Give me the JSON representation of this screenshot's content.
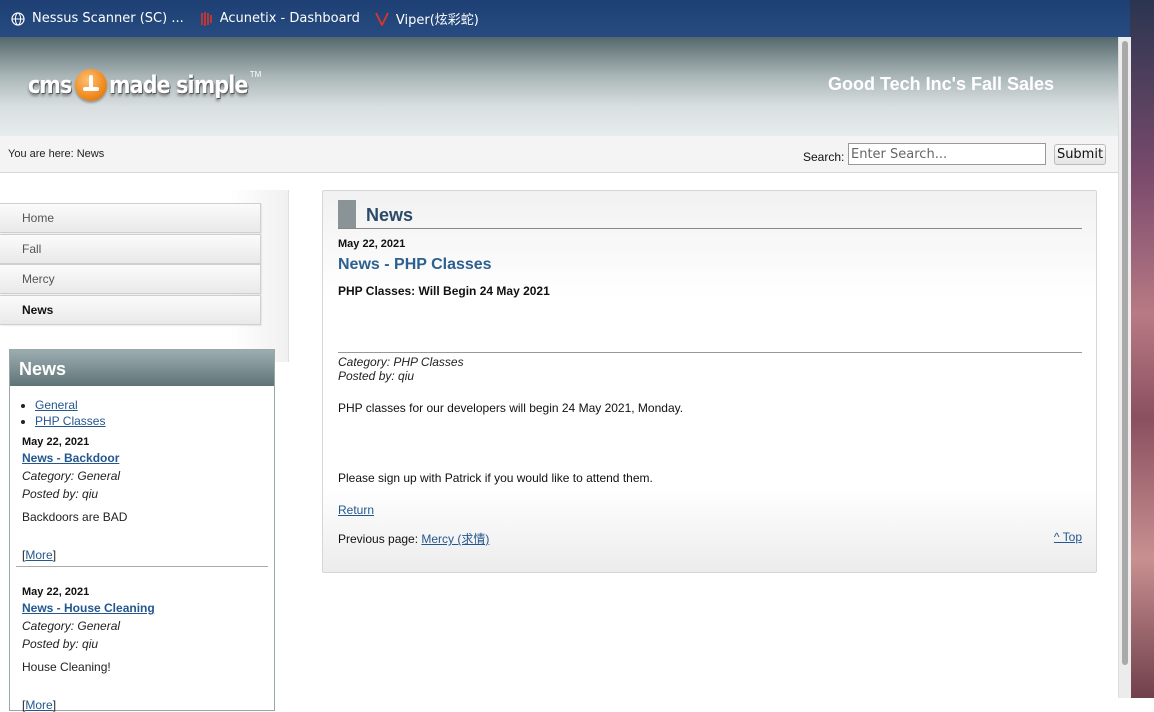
{
  "bookmarks": [
    {
      "label": "Nessus Scanner (SC) ...",
      "icon": "globe-icon"
    },
    {
      "label": "Acunetix - Dashboard",
      "icon": "acunetix-icon"
    },
    {
      "label": "Viper(炫彩蛇)",
      "icon": "viper-icon"
    }
  ],
  "header": {
    "logo": {
      "part1": "cms",
      "part2": "made simple",
      "tm": "TM"
    },
    "site_title": "Good Tech Inc's Fall Sales"
  },
  "breadcrumb": "You are here: News",
  "search": {
    "label": "Search:",
    "placeholder": "Enter Search...",
    "submit": "Submit"
  },
  "nav": {
    "items": [
      {
        "label": "Home",
        "active": false
      },
      {
        "label": "Fall",
        "active": false
      },
      {
        "label": "Mercy",
        "active": false
      },
      {
        "label": "News",
        "active": true
      }
    ]
  },
  "news_sidebar": {
    "title": "News",
    "categories": [
      "General",
      "PHP Classes"
    ],
    "items": [
      {
        "date": "May 22, 2021",
        "title": "News - Backdoor",
        "category": "Category: General",
        "posted_by": "Posted by: qiu",
        "summary": "Backdoors are BAD",
        "more": "More"
      },
      {
        "date": "May 22, 2021",
        "title": "News - House Cleaning",
        "category": "Category: General",
        "posted_by": "Posted by: qiu",
        "summary": "House Cleaning!",
        "more": "More"
      }
    ]
  },
  "content": {
    "heading": "News",
    "article": {
      "date": "May 22, 2021",
      "title": "News - PHP Classes",
      "summary": "PHP Classes: Will Begin 24 May 2021",
      "category": "Category: PHP Classes",
      "posted_by": "Posted by: qiu",
      "body": [
        "PHP classes for our developers will begin 24 May 2021, Monday.",
        "Please sign up with Patrick if you would like to attend them."
      ]
    },
    "return": "Return",
    "previous_label": "Previous page: ",
    "previous_link": "Mercy (求情)",
    "top": "^ Top"
  },
  "colors": {
    "link": "#24578e",
    "bookmark_bar": "#1d3f74",
    "heading": "#2b4a68"
  }
}
